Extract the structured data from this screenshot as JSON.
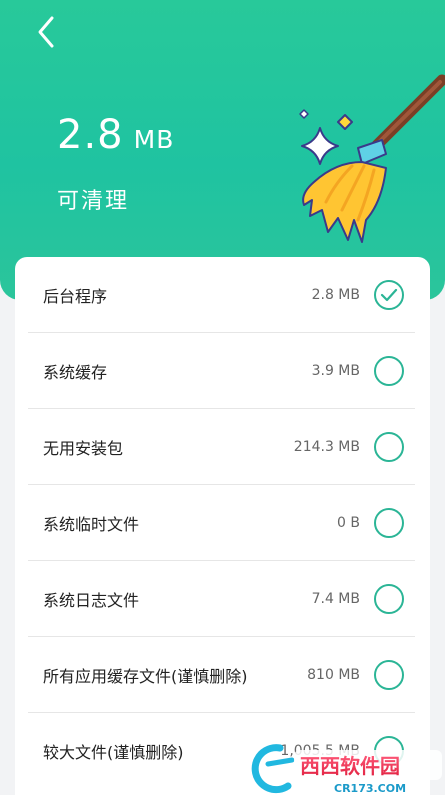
{
  "header": {
    "back_icon": "chevron-left-icon",
    "size_value": "2.8",
    "size_unit": "MB",
    "cleanable_label": "可清理",
    "illustration": "broom-icon"
  },
  "items": [
    {
      "label": "后台程序",
      "value": "2.8 MB",
      "checked": true
    },
    {
      "label": "系统缓存",
      "value": "3.9 MB",
      "checked": false
    },
    {
      "label": "无用安装包",
      "value": "214.3 MB",
      "checked": false
    },
    {
      "label": "系统临时文件",
      "value": "0 B",
      "checked": false
    },
    {
      "label": "系统日志文件",
      "value": "7.4 MB",
      "checked": false
    },
    {
      "label": "所有应用缓存文件(谨慎删除)",
      "value": "810 MB",
      "checked": false
    },
    {
      "label": "较大文件(谨慎删除)",
      "value": "1,005.5 MB",
      "checked": false
    }
  ],
  "watermark": {
    "brand": "西西软件园",
    "domain": "CR173.COM"
  },
  "colors": {
    "accent": "#2bb596",
    "header_gradient_top": "#28c99a",
    "header_gradient_bottom": "#2bc59b"
  }
}
